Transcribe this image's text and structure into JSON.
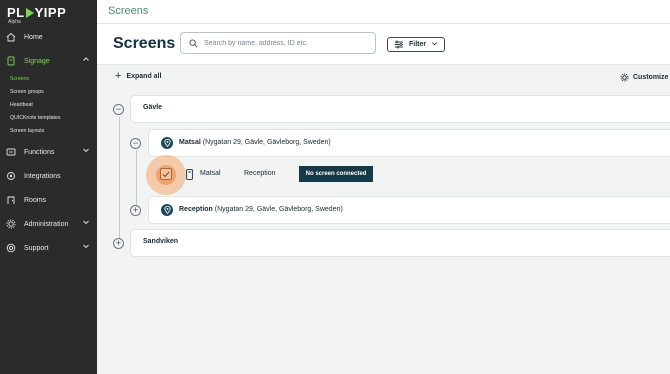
{
  "brand": {
    "name_left": "PL",
    "name_right": "YIPP",
    "env": "Alpha",
    "accent": "#7fd35a"
  },
  "sidebar": {
    "items": [
      {
        "label": "Home",
        "icon": "home-icon"
      },
      {
        "label": "Signage",
        "icon": "signage-icon",
        "active": true
      },
      {
        "label": "Functions",
        "icon": "functions-icon"
      },
      {
        "label": "Integrations",
        "icon": "integrations-icon"
      },
      {
        "label": "Rooms",
        "icon": "rooms-icon"
      },
      {
        "label": "Administration",
        "icon": "gear-icon"
      },
      {
        "label": "Support",
        "icon": "support-icon"
      }
    ],
    "signage_sub": [
      "Screens",
      "Screen groups",
      "Heartbeat",
      "QUICKnote templates",
      "Screen layouts"
    ]
  },
  "topbar": {
    "title": "Screens"
  },
  "header": {
    "page_title": "Screens",
    "search_placeholder": "Search by name, address, ID etc.",
    "filter_label": "Filter"
  },
  "toolbar": {
    "expand_all": "Expand all",
    "customize": "Customize"
  },
  "tree": {
    "group_1": "Gävle",
    "location_1": {
      "name": "Matsal",
      "address": "(Nygatan 29, Gävle, Gävleborg, Sweden)"
    },
    "screen": {
      "name": "Matsal",
      "location": "Reception",
      "status": "No screen connected",
      "status_color": "#163947"
    },
    "location_2": {
      "name": "Reception",
      "address": "(Nygatan 29, Gävle, Gävleborg, Sweden)"
    },
    "group_2": "Sandviken"
  }
}
